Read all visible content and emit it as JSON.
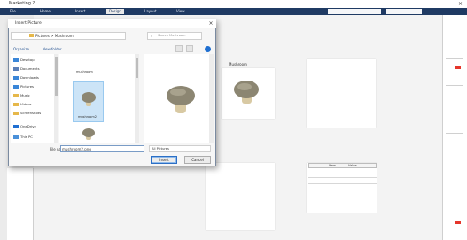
{
  "app": {
    "title": "Marketing ?",
    "tabs": [
      "File",
      "Home",
      "Insert",
      "Design",
      "Layout",
      "View"
    ],
    "active_tab": 3
  },
  "dialog": {
    "title": "Insert Picture",
    "address": "Pictures  >  Mushroom",
    "search_placeholder": "Search Mushroom",
    "organize": "Organize",
    "new_folder": "New folder",
    "nav_items": [
      {
        "label": "Desktop",
        "color": "#3a86d8"
      },
      {
        "label": "Documents",
        "color": "#5a7fb8"
      },
      {
        "label": "Downloads",
        "color": "#3a86d8"
      },
      {
        "label": "Pictures",
        "color": "#3a86d8"
      },
      {
        "label": "Music",
        "color": "#e6b84a"
      },
      {
        "label": "Videos",
        "color": "#e6b84a"
      },
      {
        "label": "Screenshots",
        "color": "#e6b84a"
      },
      {
        "label": "OneDrive",
        "color": "#1f6fd1"
      },
      {
        "label": "This PC",
        "color": "#4a90d9"
      }
    ],
    "files": [
      {
        "name": "mushroom",
        "selected": false
      },
      {
        "name": "mushroom2",
        "selected": true
      },
      {
        "name": "mushroom3",
        "selected": false
      }
    ],
    "file_name_label": "File name:",
    "file_name_value": "mushroom2.png",
    "file_type": "All Pictures",
    "insert_button": "Insert",
    "cancel_button": "Cancel"
  },
  "canvas": {
    "card_label": "Mushroom",
    "table_headers": [
      "Item",
      "Value"
    ]
  },
  "icons": [
    "close-icon",
    "minimize-icon",
    "back-icon",
    "forward-icon",
    "up-icon",
    "search-icon",
    "help-icon",
    "folder-icon",
    "mushroom-image"
  ]
}
